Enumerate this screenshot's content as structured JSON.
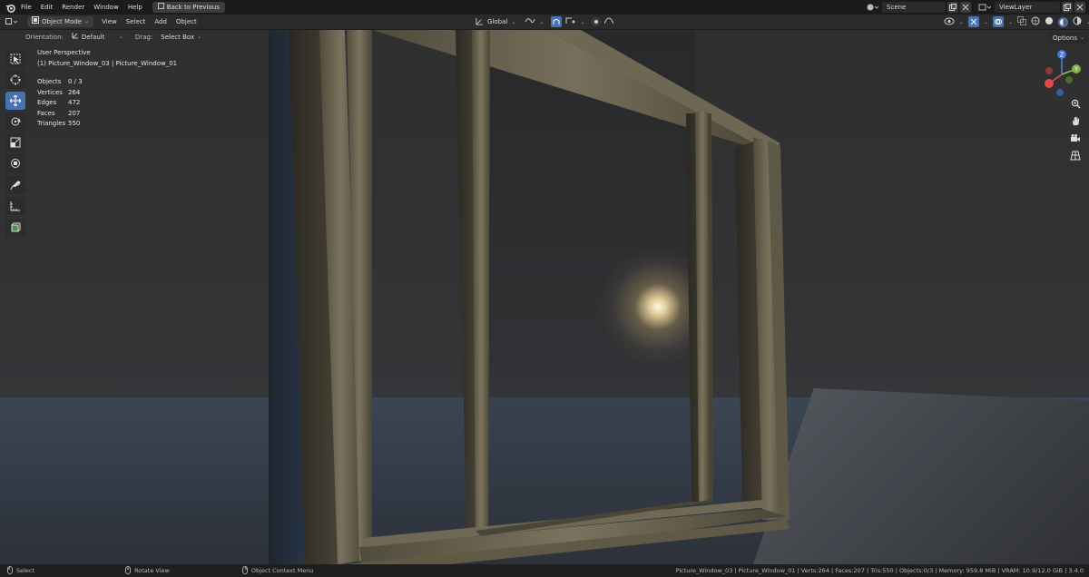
{
  "menubar": {
    "items": [
      "File",
      "Edit",
      "Render",
      "Window",
      "Help"
    ],
    "back_button": "Back to Previous",
    "scene_label": "Scene",
    "view_layer_label": "ViewLayer"
  },
  "header": {
    "mode": "Object Mode",
    "menus": [
      "View",
      "Select",
      "Add",
      "Object"
    ],
    "transform_orientation": "Global",
    "orientation_label": "Orientation:",
    "orientation_value": "Default",
    "drag_label": "Drag:",
    "drag_value": "Select Box",
    "options_label": "Options"
  },
  "viewport": {
    "perspective": "User Perspective",
    "active_object": "(1) Picture_Window_03 | Picture_Window_01",
    "stats": [
      {
        "key": "Objects",
        "value": "0 / 3"
      },
      {
        "key": "Vertices",
        "value": "264"
      },
      {
        "key": "Edges",
        "value": "472"
      },
      {
        "key": "Faces",
        "value": "207"
      },
      {
        "key": "Triangles",
        "value": "550"
      }
    ],
    "gizmo_axes": {
      "z": "Z",
      "y": "Y",
      "x": "X"
    }
  },
  "tools": [
    "select-box-tool",
    "cursor-tool",
    "move-tool",
    "rotate-tool",
    "scale-tool",
    "transform-tool",
    "annotate-tool",
    "measure-tool",
    "add-cube-tool"
  ],
  "statusbar": {
    "select": "Select",
    "rotate": "Rotate View",
    "context": "Object Context Menu",
    "info": "Picture_Window_03 | Picture_Window_01 | Verts:264 | Faces:207 | Tris:550 | Objects:0/3 | Memory: 959.8 MiB | VRAM: 10.9/12.0 GiB | 3.4.0"
  },
  "colors": {
    "accent": "#4772b3",
    "frame": "#6b6450"
  }
}
